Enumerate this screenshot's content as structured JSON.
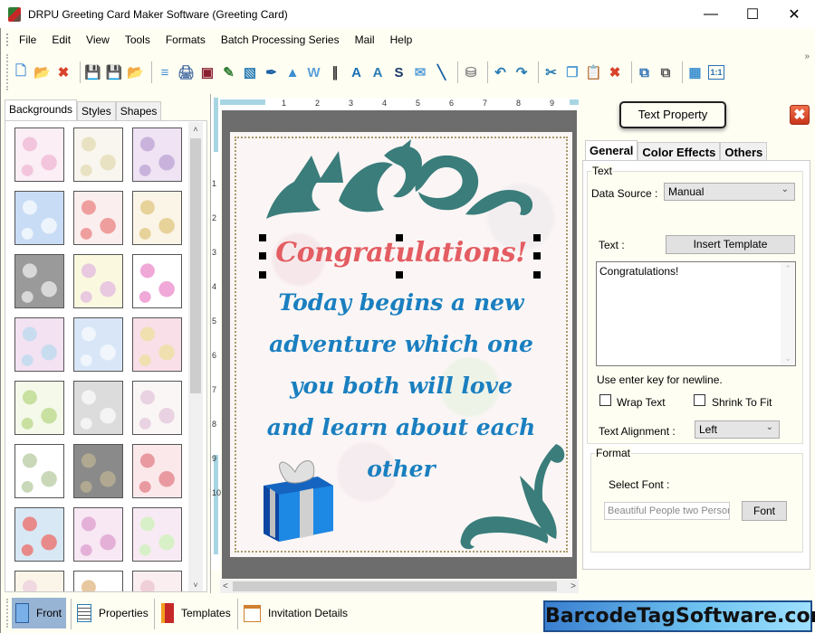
{
  "window": {
    "title": "DRPU Greeting Card Maker Software (Greeting Card)",
    "controls": {
      "minimize": "—",
      "maximize": "☐",
      "close": "✕"
    }
  },
  "menu": [
    "File",
    "Edit",
    "View",
    "Tools",
    "Formats",
    "Batch Processing Series",
    "Mail",
    "Help"
  ],
  "toolbar": {
    "overflow": "»",
    "groups": [
      [
        {
          "name": "new-icon",
          "glyph": "🗋",
          "color": "#4a90d9"
        },
        {
          "name": "open-icon",
          "glyph": "📂",
          "color": "#e3a72f"
        },
        {
          "name": "close-doc-icon",
          "glyph": "✖",
          "color": "#d9432b"
        }
      ],
      [
        {
          "name": "save-icon",
          "glyph": "💾",
          "color": "#4a90d9"
        },
        {
          "name": "save-as-icon",
          "glyph": "💾",
          "color": "#4a90d9"
        },
        {
          "name": "export-icon",
          "glyph": "📂",
          "color": "#e3a72f"
        }
      ],
      [
        {
          "name": "properties-icon",
          "glyph": "≡",
          "color": "#4a90d9"
        },
        {
          "name": "print-icon",
          "glyph": "🖨",
          "color": "#4a6fa5"
        },
        {
          "name": "background-icon",
          "glyph": "▣",
          "color": "#8b2030"
        },
        {
          "name": "paint-icon",
          "glyph": "✎",
          "color": "#2e7d32"
        },
        {
          "name": "insert-image-icon",
          "glyph": "▧",
          "color": "#2a7db5"
        },
        {
          "name": "pen-icon",
          "glyph": "✒",
          "color": "#1a5fa5"
        },
        {
          "name": "shapes-icon",
          "glyph": "▲",
          "color": "#3a8fd0"
        },
        {
          "name": "watermark-icon",
          "glyph": "W",
          "color": "#5aa0d8"
        },
        {
          "name": "barcode-icon",
          "glyph": "∥",
          "color": "#333"
        },
        {
          "name": "text-icon",
          "glyph": "A",
          "color": "#1a6fb5"
        },
        {
          "name": "text-art-icon",
          "glyph": "A",
          "color": "#2a7db5"
        },
        {
          "name": "signature-icon",
          "glyph": "S",
          "color": "#1a3a6b"
        },
        {
          "name": "mail-icon",
          "glyph": "✉",
          "color": "#5aa0d8"
        },
        {
          "name": "line-icon",
          "glyph": "╲",
          "color": "#1a5fa5"
        }
      ],
      [
        {
          "name": "database-icon",
          "glyph": "⛁",
          "color": "#888"
        }
      ],
      [
        {
          "name": "undo-icon",
          "glyph": "↶",
          "color": "#2a7db5"
        },
        {
          "name": "redo-icon",
          "glyph": "↷",
          "color": "#2a7db5"
        }
      ],
      [
        {
          "name": "cut-icon",
          "glyph": "✂",
          "color": "#2a7db5"
        },
        {
          "name": "copy-icon",
          "glyph": "❐",
          "color": "#5aa0d8"
        },
        {
          "name": "paste-icon",
          "glyph": "📋",
          "color": "#c89a40"
        },
        {
          "name": "delete-icon",
          "glyph": "✖",
          "color": "#d9432b"
        }
      ],
      [
        {
          "name": "bring-front-icon",
          "glyph": "⧉",
          "color": "#2a6fb5"
        },
        {
          "name": "send-back-icon",
          "glyph": "⧉",
          "color": "#555"
        }
      ],
      [
        {
          "name": "grid-icon",
          "glyph": "▦",
          "color": "#3a8fd0"
        },
        {
          "name": "actual-size-icon",
          "glyph": "1:1",
          "color": "#2a6fb5"
        }
      ]
    ]
  },
  "left_panel": {
    "tabs": [
      "Backgrounds",
      "Styles",
      "Shapes"
    ],
    "active_tab": "Backgrounds",
    "thumbnails": [
      {
        "name": "baby-pink",
        "colors": [
          "#fbeef5",
          "#f2c5dc"
        ]
      },
      {
        "name": "baby-items",
        "colors": [
          "#f8f6ee",
          "#e9e2c2"
        ]
      },
      {
        "name": "purple-flowers",
        "colors": [
          "#efe3f4",
          "#c9b3dc"
        ]
      },
      {
        "name": "sky-clouds",
        "colors": [
          "#c8dcf5",
          "#eef4fc"
        ]
      },
      {
        "name": "strawberries",
        "colors": [
          "#fbeeee",
          "#ef9e9e"
        ]
      },
      {
        "name": "autumn-leaves",
        "colors": [
          "#fbf5e8",
          "#e7d29a"
        ]
      },
      {
        "name": "grey-hearts",
        "colors": [
          "#9a9a9a",
          "#d8d8d8"
        ]
      },
      {
        "name": "confetti-hearts",
        "colors": [
          "#fbf8e0",
          "#e8c9e0"
        ]
      },
      {
        "name": "gift-boxes",
        "colors": [
          "#ffffff",
          "#f0a8d8"
        ]
      },
      {
        "name": "pastel-flowers",
        "colors": [
          "#f3e2f2",
          "#c8dcf0"
        ]
      },
      {
        "name": "snowflakes",
        "colors": [
          "#d8e6f8",
          "#f0f6fc"
        ]
      },
      {
        "name": "pastel-circles",
        "colors": [
          "#f8dfe8",
          "#f0e0b0"
        ]
      },
      {
        "name": "green-trees",
        "colors": [
          "#f4f9ea",
          "#c8e0a0"
        ]
      },
      {
        "name": "white-heart",
        "colors": [
          "#dcdcdc",
          "#f4f4f4"
        ]
      },
      {
        "name": "toys",
        "colors": [
          "#fbf6f6",
          "#e9d3e2"
        ]
      },
      {
        "name": "ornaments",
        "colors": [
          "#ffffff",
          "#c8d8b8"
        ]
      },
      {
        "name": "sparkles",
        "colors": [
          "#8a8a8a",
          "#b0a890"
        ]
      },
      {
        "name": "red-hearts",
        "colors": [
          "#fbe8ea",
          "#e89aa0"
        ]
      },
      {
        "name": "santa",
        "colors": [
          "#d8e8f4",
          "#e88a8a"
        ]
      },
      {
        "name": "pink-dandelions",
        "colors": [
          "#f8e8f4",
          "#e4b0d8"
        ]
      },
      {
        "name": "butterflies",
        "colors": [
          "#f8eaf4",
          "#d8f0c8"
        ]
      },
      {
        "name": "stripes",
        "colors": [
          "#fbf4e8",
          "#f0d8e0"
        ]
      },
      {
        "name": "teddy-bear",
        "colors": [
          "#ffffff",
          "#e8c8a0"
        ]
      },
      {
        "name": "pink-pattern",
        "colors": [
          "#fbeef0",
          "#f0d0d8"
        ]
      }
    ],
    "scroll_up": "˄",
    "scroll_down": "˅"
  },
  "canvas": {
    "ruler_h": [
      "1",
      "2",
      "3",
      "4",
      "5",
      "6",
      "7",
      "8",
      "9"
    ],
    "ruler_v": [
      "1",
      "2",
      "3",
      "4",
      "5",
      "6",
      "7",
      "8",
      "9",
      "10"
    ],
    "card": {
      "title": "Congratulations!",
      "body_lines": [
        "Today begins a new",
        "adventure which one",
        "you both will love",
        "and learn about each",
        "other"
      ],
      "title_color": "#e35d62",
      "body_color": "#1a7fc0",
      "ornament_color": "#3a7d7b"
    },
    "scroll_left": "<",
    "scroll_right": ">"
  },
  "text_property": {
    "title": "Text Property",
    "close": "✖",
    "tabs": [
      "General",
      "Color Effects",
      "Others"
    ],
    "active_tab": "General",
    "text_group": {
      "legend": "Text",
      "data_source_label": "Data Source :",
      "data_source_value": "Manual",
      "text_label": "Text :",
      "insert_template": "Insert Template",
      "text_value": "Congratulations!",
      "hint": "Use enter key for newline.",
      "wrap_text": {
        "label": "Wrap Text",
        "checked": false
      },
      "shrink_to_fit": {
        "label": "Shrink To Fit",
        "checked": false
      },
      "alignment_label": "Text Alignment :",
      "alignment_value": "Left"
    },
    "format_group": {
      "legend": "Format",
      "select_font_label": "Select Font :",
      "font_value": "Beautiful People two Personal",
      "font_button": "Font"
    }
  },
  "bottom_bar": {
    "items": [
      {
        "label": "Front",
        "active": true
      },
      {
        "label": "Properties",
        "active": false
      },
      {
        "label": "Templates",
        "active": false
      },
      {
        "label": "Invitation Details",
        "active": false
      }
    ]
  },
  "brand": "BarcodeTagSoftware.com"
}
